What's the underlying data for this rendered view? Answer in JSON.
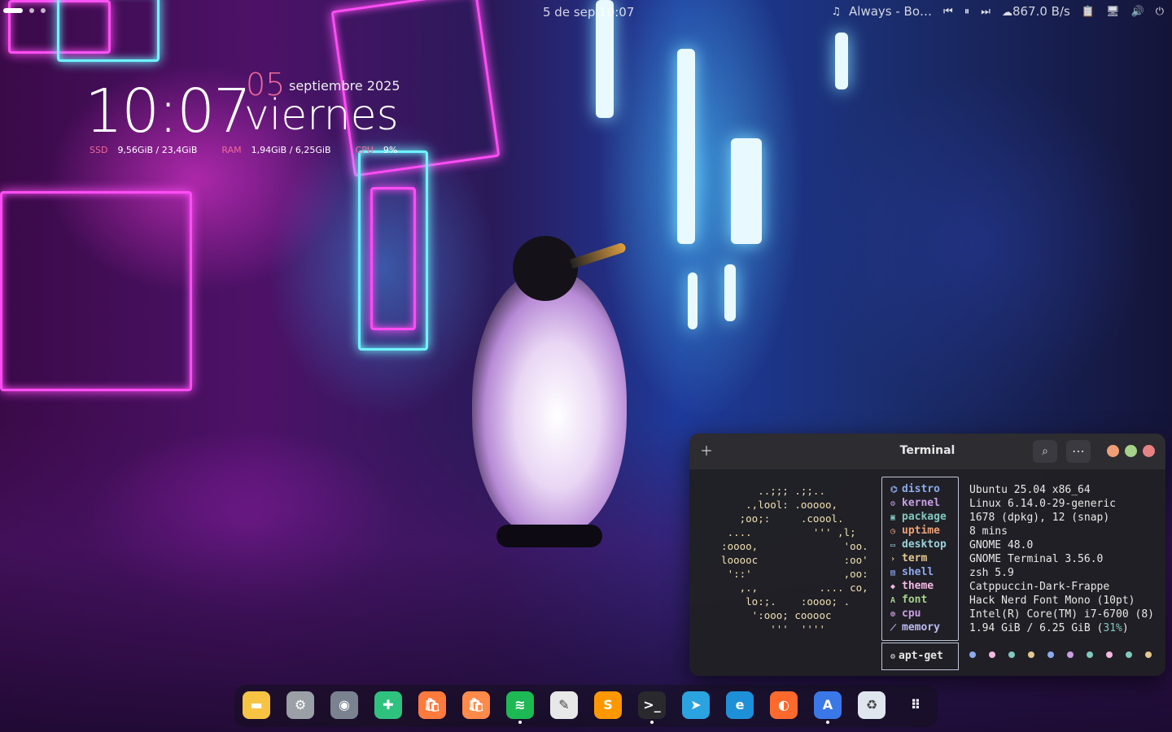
{
  "topbar": {
    "datetime": "5 de sep  10:07",
    "media_icon": "music-note-icon",
    "media_title": "Always - Bo…",
    "net_speed": "867.0 B/s"
  },
  "widget": {
    "time": "10:07",
    "day_number": "05",
    "month_year": "septiembre 2025",
    "weekday": "viernes",
    "ssd_label": "SSD",
    "ssd_value": "9,56GiB / 23,4GiB",
    "ram_label": "RAM",
    "ram_value": "1,94GiB / 6,25GiB",
    "cpu_label": "CPU",
    "cpu_value": "9%"
  },
  "terminal": {
    "title": "Terminal",
    "ascii": "        ..;;; .;;..\n      .,lool: .ooooo,\n     ;oo;:     .coool.\n   ....          ''' ,l;\n  :oooo,              'oo.\n  looooc              :oo'\n   '::'               ,oo:\n     ,.,          .... co,\n      lo:;.    :oooo; .\n       ':ooo; cooooc\n          '''  ''''",
    "keys": [
      "distro",
      "kernel",
      "package",
      "uptime",
      "desktop",
      "term",
      "shell",
      "theme",
      "font",
      "cpu",
      "memory"
    ],
    "key_colors": [
      "#8caaee",
      "#ca9ee6",
      "#81c8be",
      "#ef9f76",
      "#99d1db",
      "#e5c890",
      "#8caaee",
      "#f4b8e4",
      "#a6d189",
      "#ca9ee6",
      "#babbf1"
    ],
    "values": [
      "Ubuntu 25.04 x86_64",
      "Linux 6.14.0-29-generic",
      "1678 (dpkg), 12 (snap)",
      "8 mins",
      "GNOME 48.0",
      "GNOME Terminal 3.56.0",
      "zsh 5.9",
      "Catppuccin-Dark-Frappe",
      "Hack Nerd Font Mono (10pt)",
      "Intel(R) Core(TM) i7-6700 (8)",
      "1.94 GiB / 6.25 GiB (31%)"
    ],
    "footer_key": "apt-get",
    "palette": [
      "#8caaee",
      "#f4b8e4",
      "#81c8be",
      "#e5c890",
      "#8caaee",
      "#ca9ee6",
      "#81c8be",
      "#f4b8e4",
      "#81c8be",
      "#e5c890"
    ],
    "window_buttons": [
      "#ef9f76",
      "#a6d189",
      "#e78284"
    ]
  },
  "dock": {
    "apps": [
      {
        "name": "files-icon",
        "color": "#f6c343",
        "running": false
      },
      {
        "name": "settings-icon",
        "color": "#9aa0a6",
        "running": false
      },
      {
        "name": "toggle-icon",
        "color": "#7a8290",
        "running": false
      },
      {
        "name": "extensions-icon",
        "color": "#2ec27e",
        "running": false
      },
      {
        "name": "shop-icon",
        "color": "#ff7a3d",
        "running": false
      },
      {
        "name": "shop-alt-icon",
        "color": "#ff8a4a",
        "running": false
      },
      {
        "name": "spotify-icon",
        "color": "#1db954",
        "running": true
      },
      {
        "name": "text-editor-icon",
        "color": "#e8e8e8",
        "running": false
      },
      {
        "name": "sublime-icon",
        "color": "#ff9800",
        "running": false
      },
      {
        "name": "terminal-icon",
        "color": "#2a2a2e",
        "running": true
      },
      {
        "name": "telegram-icon",
        "color": "#2aa3e0",
        "running": false
      },
      {
        "name": "edge-icon",
        "color": "#1e90d8",
        "running": false
      },
      {
        "name": "firefox-icon",
        "color": "#ff6a2c",
        "running": false
      },
      {
        "name": "app-store-icon",
        "color": "#3a78e8",
        "running": true
      },
      {
        "name": "trash-icon",
        "color": "#dfe6ee",
        "running": false
      },
      {
        "name": "app-grid-icon",
        "color": "#ffffff",
        "running": false
      }
    ]
  }
}
